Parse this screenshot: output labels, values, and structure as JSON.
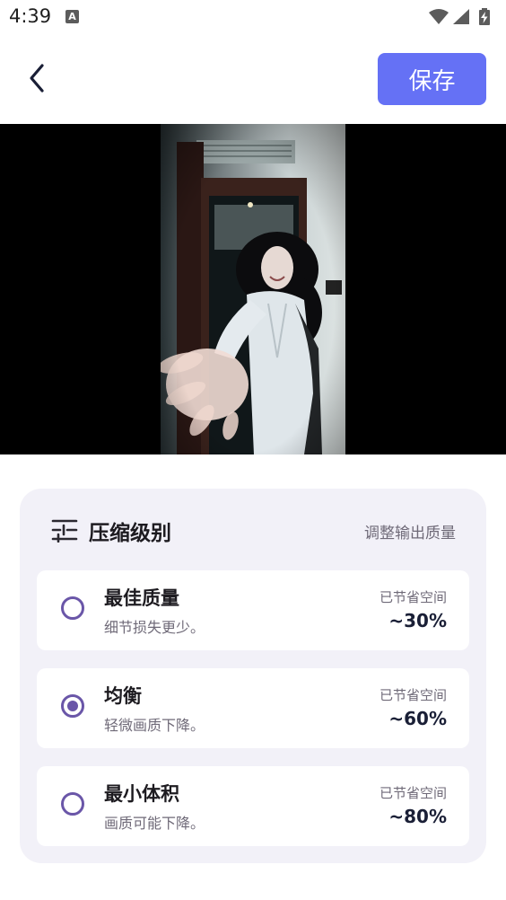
{
  "status_bar": {
    "time": "4:39",
    "notification_icon": "A",
    "icons": [
      "wifi-icon",
      "cellular-signal-icon",
      "battery-charging-icon"
    ]
  },
  "app_bar": {
    "back_icon": "chevron-left-icon",
    "save_label": "保存"
  },
  "preview": {
    "image_icon": "photo-image"
  },
  "compression": {
    "title": "压缩级别",
    "subtitle": "调整输出质量",
    "title_icon": "tune-sliders-icon",
    "options": [
      {
        "title": "最佳质量",
        "description": "细节损失更少。",
        "saved_label": "已节省空间",
        "saved_value": "~30%",
        "selected": false
      },
      {
        "title": "均衡",
        "description": "轻微画质下降。",
        "saved_label": "已节省空间",
        "saved_value": "~60%",
        "selected": true
      },
      {
        "title": "最小体积",
        "description": "画质可能下降。",
        "saved_label": "已节省空间",
        "saved_value": "~80%",
        "selected": false
      }
    ]
  },
  "colors": {
    "accent": "#6571f5",
    "radio": "#6a56a8",
    "panel_background": "#f2f1f8",
    "text_primary": "#1d1b20",
    "text_secondary": "#6f6a78"
  }
}
